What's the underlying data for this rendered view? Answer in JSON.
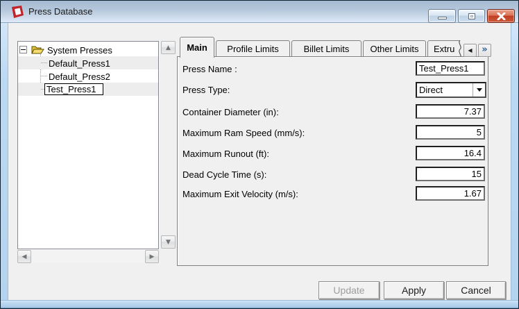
{
  "window": {
    "title": "Press Database"
  },
  "tree": {
    "root_label": "System Presses",
    "children": [
      "Default_Press1",
      "Default_Press2",
      "Test_Press1"
    ],
    "editing_item_value": "Test_Press1"
  },
  "tabs": {
    "items": [
      "Main",
      "Profile Limits",
      "Billet Limits",
      "Other Limits",
      "Extru"
    ],
    "selected": "Main"
  },
  "form": {
    "press_name": {
      "label": "Press Name :",
      "value": "Test_Press1"
    },
    "press_type": {
      "label": "Press Type:",
      "value": "Direct"
    },
    "container_diameter": {
      "label": "Container Diameter (in):",
      "value": "7.37"
    },
    "max_ram_speed": {
      "label": "Maximum Ram Speed (mm/s):",
      "value": "5"
    },
    "max_runout": {
      "label": "Maximum Runout (ft):",
      "value": "16.4"
    },
    "dead_cycle_time": {
      "label": "Dead Cycle Time (s):",
      "value": "15"
    },
    "max_exit_velocity": {
      "label": "Maximum Exit Velocity (m/s):",
      "value": "1.67"
    }
  },
  "buttons": {
    "update": "Update",
    "apply": "Apply",
    "cancel": "Cancel"
  },
  "icons": {
    "app": "qform-logo-icon",
    "titlebar": [
      "minimize-icon",
      "maximize-icon",
      "close-icon"
    ],
    "tree": [
      "expand-minus-icon",
      "open-folder-icon"
    ],
    "scrollbars": [
      "up-arrow-icon",
      "down-arrow-icon",
      "left-arrow-icon",
      "right-arrow-icon"
    ],
    "tab_scroller": [
      "tab-scroll-left-icon",
      "tab-scroll-right-icon"
    ],
    "combo": "dropdown-arrow-icon"
  },
  "colors": {
    "frame_blue": "#b7d5ef",
    "titlebar_top": "#a4bad1",
    "client_bg": "#f0f0f0",
    "close_red": "#c03f22",
    "disabled_text": "#9d9d9d",
    "tree_band_gray": "#ededed"
  }
}
